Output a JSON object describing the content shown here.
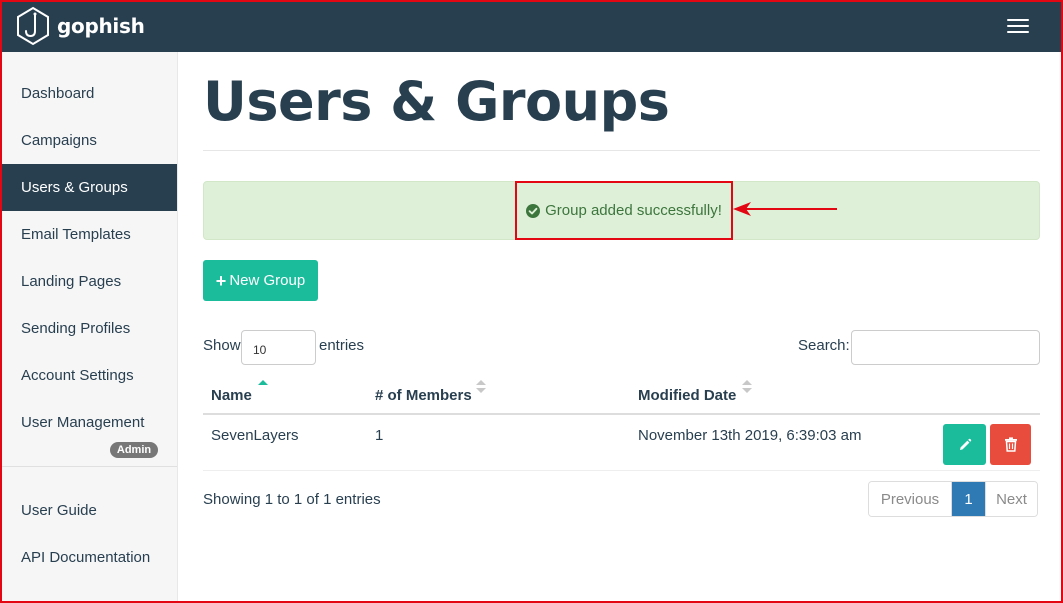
{
  "app": {
    "name": "gophish"
  },
  "sidebar": {
    "items": [
      {
        "label": "Dashboard"
      },
      {
        "label": "Campaigns"
      },
      {
        "label": "Users & Groups",
        "active": true
      },
      {
        "label": "Email Templates"
      },
      {
        "label": "Landing Pages"
      },
      {
        "label": "Sending Profiles"
      },
      {
        "label": "Account Settings"
      },
      {
        "label": "User Management",
        "badge": "Admin"
      }
    ],
    "footer_items": [
      {
        "label": "User Guide"
      },
      {
        "label": "API Documentation"
      }
    ]
  },
  "page": {
    "title": "Users & Groups"
  },
  "alert": {
    "message": "Group added successfully!",
    "icon": "check-circle-icon"
  },
  "actions": {
    "new_group_label": "New Group"
  },
  "table_controls": {
    "show_label": "Show",
    "entries_value": "10",
    "entries_label": "entries",
    "search_label": "Search:",
    "search_value": ""
  },
  "table": {
    "columns": [
      "Name",
      "# of Members",
      "Modified Date"
    ],
    "sorted_column": "Name",
    "sort_direction": "asc",
    "rows": [
      {
        "name": "SevenLayers",
        "members": "1",
        "modified": "November 13th 2019, 6:39:03 am"
      }
    ]
  },
  "footer": {
    "info": "Showing 1 to 1 of 1 entries"
  },
  "pagination": {
    "previous": "Previous",
    "current": "1",
    "next": "Next"
  },
  "colors": {
    "navbar": "#283f50",
    "accent": "#1abc9c",
    "danger": "#e74c3c",
    "success_bg": "#dff0d8",
    "success_text": "#3c763d",
    "pagination_active": "#2f7ab5",
    "annotation": "#e30613"
  }
}
